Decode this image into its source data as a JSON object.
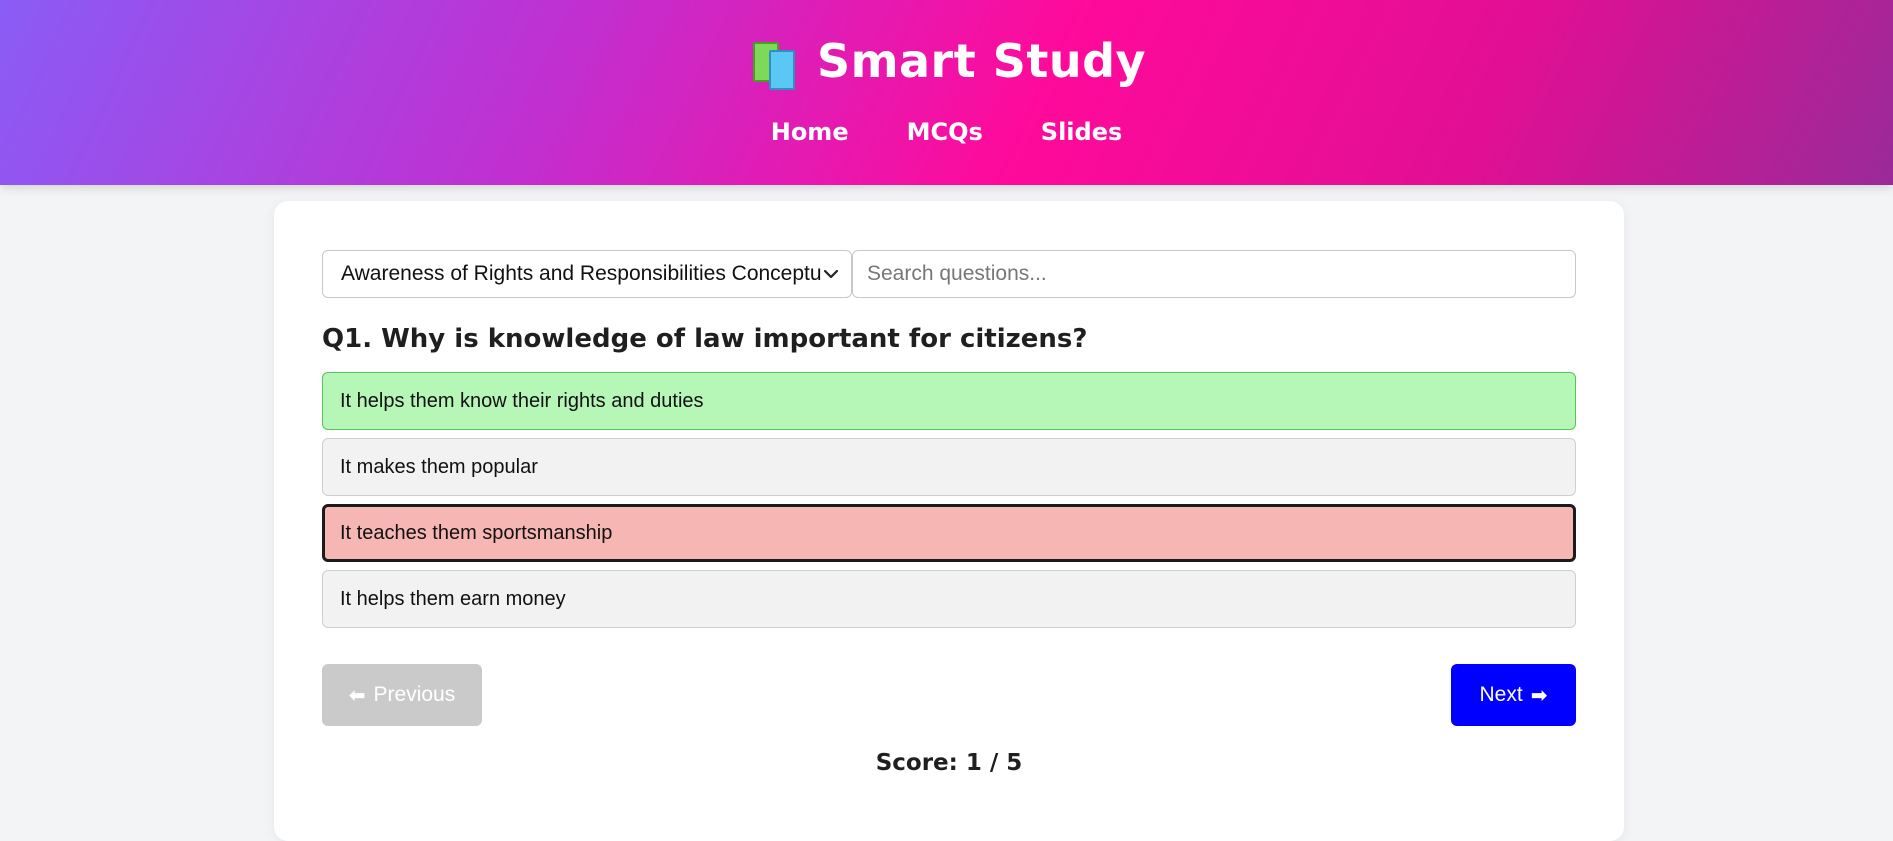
{
  "header": {
    "title": "Smart Study",
    "icon": "books-icon",
    "nav": [
      {
        "label": "Home"
      },
      {
        "label": "MCQs"
      },
      {
        "label": "Slides"
      }
    ]
  },
  "controls": {
    "topic_selected": "Awareness of Rights and Responsibilities Conceptual",
    "search_placeholder": "Search questions...",
    "search_value": ""
  },
  "question": {
    "text": "Q1. Why is knowledge of law important for citizens?",
    "options": [
      {
        "label": "It helps them know their rights and duties",
        "state": "correct"
      },
      {
        "label": "It makes them popular",
        "state": "neutral"
      },
      {
        "label": "It teaches them sportsmanship",
        "state": "wrong-selected"
      },
      {
        "label": "It helps them earn money",
        "state": "neutral"
      }
    ]
  },
  "buttons": {
    "prev_label": "Previous",
    "prev_arrow": "⬅",
    "next_label": "Next",
    "next_arrow": "➡"
  },
  "score": {
    "text": "Score: 1 / 5"
  },
  "colors": {
    "correct_bg": "#b6f7b8",
    "wrong_bg": "#f6b6b4",
    "next_button": "#0000ff",
    "prev_button_disabled": "#cacaca"
  }
}
